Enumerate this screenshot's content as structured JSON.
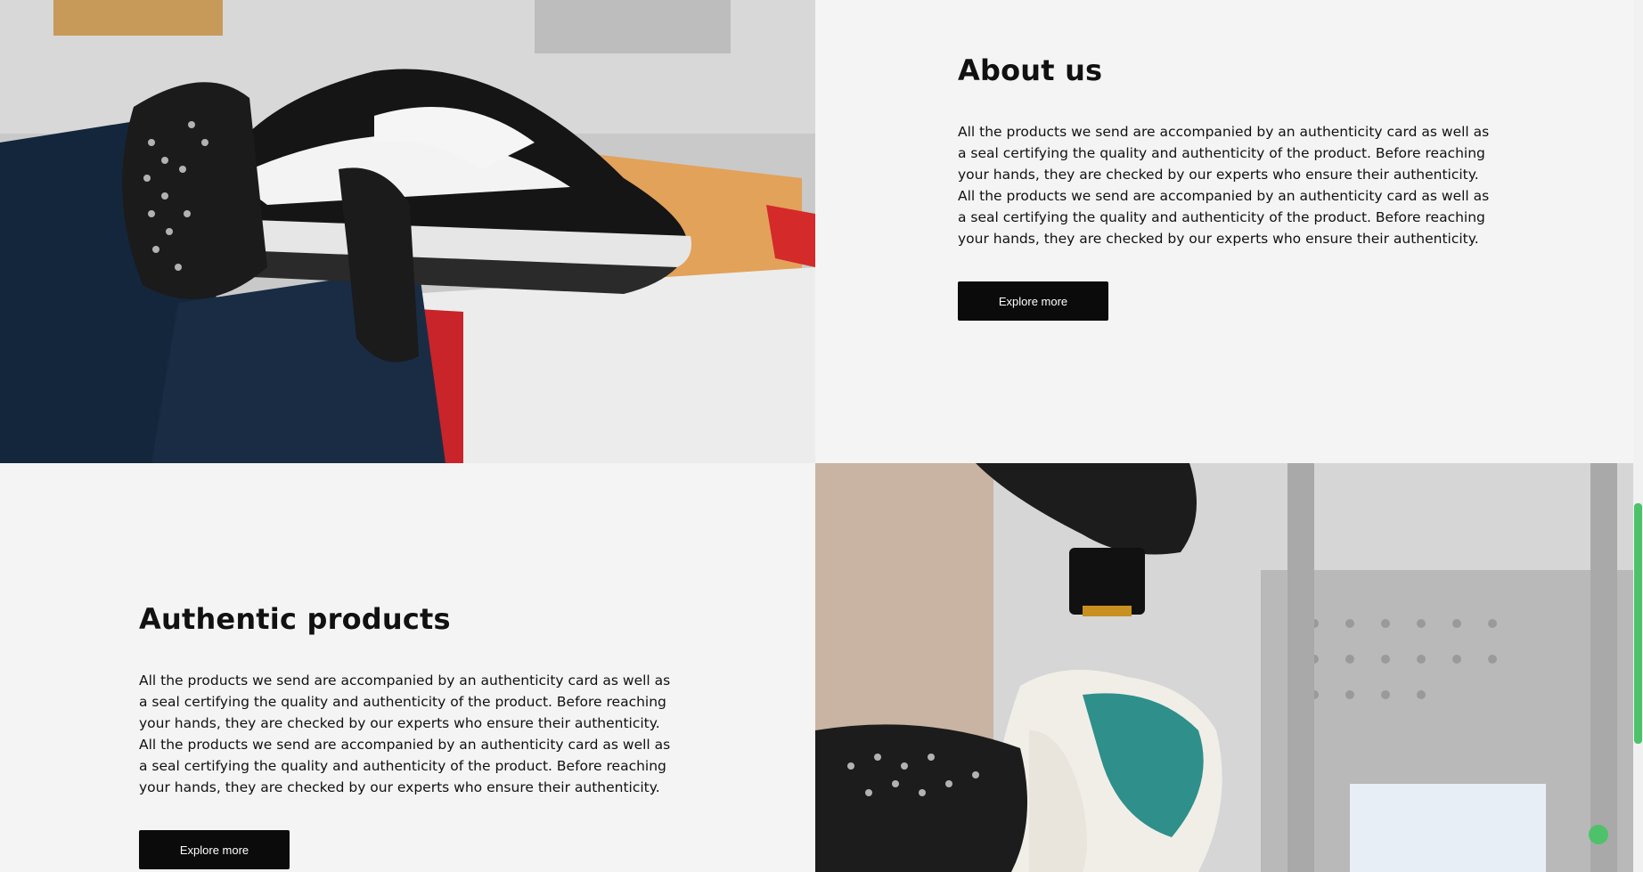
{
  "about": {
    "title": "About us",
    "body": "All the products we send are accompanied by an authenticity card as well as a seal certifying the quality and authenticity of the product. Before reaching your hands, they are checked by our experts who ensure their authenticity. All the products we send are accompanied by an authenticity card as well as a seal certifying the quality and authenticity of the product. Before reaching your hands, they are checked by our experts who ensure their authenticity.",
    "button_label": "Explore more",
    "photo": "gloved-hands-holding-black-white-sneaker"
  },
  "authentic": {
    "title": "Authentic products",
    "body": "All the products we send are accompanied by an authenticity card as well as a seal certifying the quality and authenticity of the product. Before reaching your hands, they are checked by our experts who ensure their authenticity. All the products we send are accompanied by an authenticity card as well as a seal certifying the quality and authenticity of the product. Before reaching your hands, they are checked by our experts who ensure their authenticity.",
    "button_label": "Explore more",
    "photo": "inspecting-teal-sneaker-under-light"
  },
  "colors": {
    "background": "#f4f4f4",
    "button": "#0b0b0b",
    "accent": "#4ec26a"
  }
}
